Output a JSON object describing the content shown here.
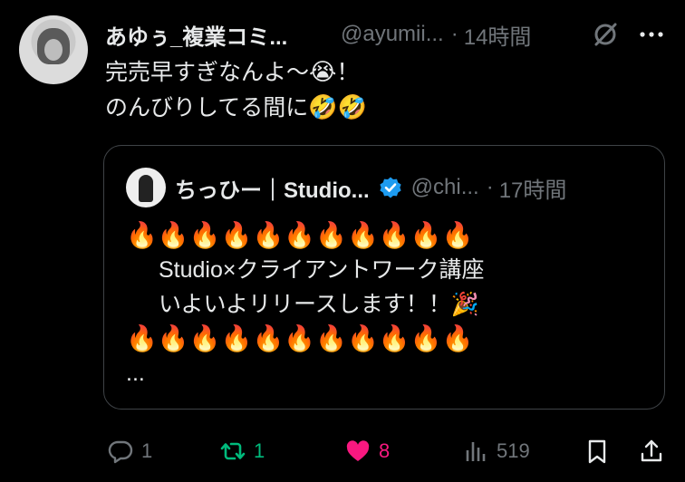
{
  "tweet": {
    "display_name": "あゆぅ_複業コミ...",
    "handle": "@ayumii...",
    "separator": "·",
    "time": "14時間",
    "text_line1": "完売早すぎなんよ〜",
    "emoji1": "😭",
    "text_line1_end": "！",
    "text_line2": "のんびりしてる間に",
    "emoji2": "🤣🤣"
  },
  "quote": {
    "display_name": "ちっひー｜Studio...",
    "handle": "@chi...",
    "separator": "·",
    "time": "17時間",
    "fire_row": "🔥🔥🔥🔥🔥🔥🔥🔥🔥🔥🔥",
    "line1": "Studio×クライアントワーク講座",
    "line2": "いよいよリリースします！！",
    "party": "🎉",
    "ellipsis": "..."
  },
  "actions": {
    "reply_count": "1",
    "retweet_count": "1",
    "like_count": "8",
    "view_count": "519"
  },
  "colors": {
    "background": "#000000",
    "text": "#e7e9ea",
    "muted": "#71767b",
    "retweet_active": "#00ba7c",
    "like_active": "#f91880",
    "verified": "#1d9bf0"
  },
  "icons": [
    "grok-icon",
    "more-icon",
    "verified-icon",
    "reply-icon",
    "retweet-icon",
    "like-icon",
    "views-icon",
    "bookmark-icon",
    "share-icon"
  ]
}
